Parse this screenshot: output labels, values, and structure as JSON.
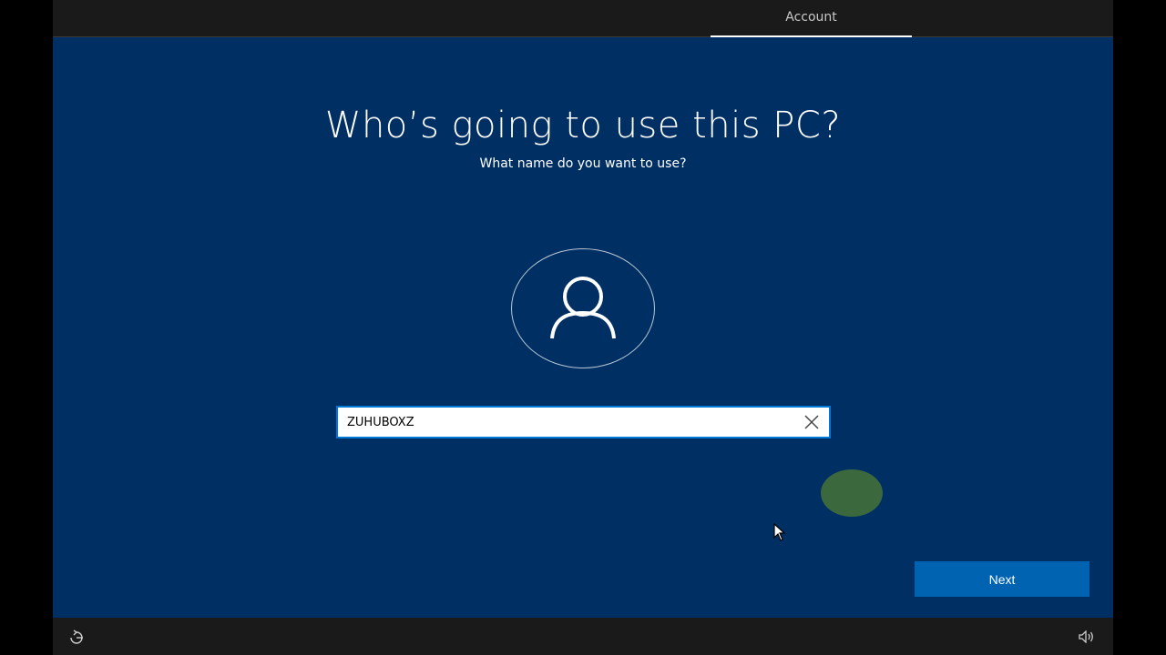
{
  "header": {
    "tab_label": "Account"
  },
  "main": {
    "title": "Who’s going to use this PC?",
    "subtitle": "What name do you want to use?",
    "avatar_icon": "user-icon",
    "name_field": {
      "value": "ZUHUBOXZ",
      "clear_icon": "close-icon"
    },
    "next_label": "Next"
  },
  "footer": {
    "left_icon": "ease-of-access-icon",
    "right_icon": "volume-icon"
  },
  "colors": {
    "background": "#003063",
    "accent": "#0063b1",
    "field_border": "#0078d7",
    "bar": "#1a1a1a"
  }
}
